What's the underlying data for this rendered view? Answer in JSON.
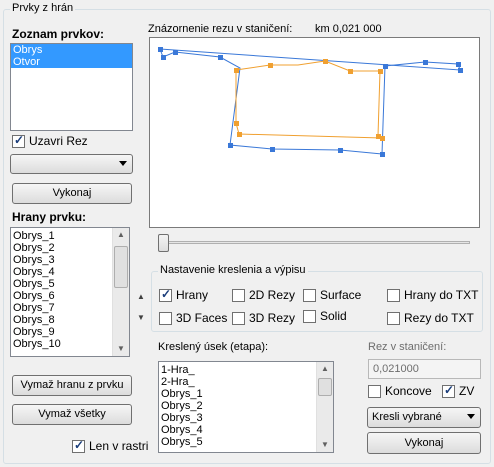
{
  "group_title": "Prvky z hrán",
  "left": {
    "elements_title": "Zoznam prvkov:",
    "elements": [
      "Obrys",
      "Otvor"
    ],
    "close_section_label": "Uzavri Rez",
    "combo_value": "",
    "execute_label": "Vykonaj",
    "edges_title": "Hrany prvku:",
    "edges": [
      "Obrys_1",
      "Obrys_2",
      "Obrys_3",
      "Obrys_4",
      "Obrys_5",
      "Obrys_6",
      "Obrys_7",
      "Obrys_8",
      "Obrys_9",
      "Obrys_10"
    ],
    "delete_edge_label": "Vymaž hranu z prvku",
    "delete_all_label": "Vymaž všetky",
    "raster_only_label": "Len v rastri"
  },
  "preview": {
    "title": "Znázornenie rezu v staničení:",
    "station": "km 0,021 000"
  },
  "settings": {
    "title": "Nastavenie kreslenia a výpisu",
    "options": [
      {
        "label": "Hrany",
        "checked": true
      },
      {
        "label": "2D Rezy",
        "checked": false
      },
      {
        "label": "Surface",
        "checked": false
      },
      {
        "label": "Hrany do TXT",
        "checked": false
      },
      {
        "label": "3D Faces",
        "checked": false
      },
      {
        "label": "3D Rezy",
        "checked": false
      },
      {
        "label": "Solid",
        "checked": false
      },
      {
        "label": "Rezy do TXT",
        "checked": false
      }
    ]
  },
  "stage": {
    "title": "Kreslený úsek (etapa):",
    "items": [
      "1-Hra_",
      "2-Hra_",
      "Obrys_1",
      "Obrys_2",
      "Obrys_3",
      "Obrys_4",
      "Obrys_5"
    ]
  },
  "station_box": {
    "title": "Rez v staničení:",
    "value": "0,021000",
    "end_label": "Koncove",
    "end_checked": false,
    "zv_label": "ZV",
    "zv_checked": true,
    "draw_mode": "Kresli vybrané",
    "execute_label": "Vykonaj"
  },
  "colors": {
    "outline": "#3a78d8",
    "opening": "#f0a030",
    "selection": "#3399ff"
  }
}
